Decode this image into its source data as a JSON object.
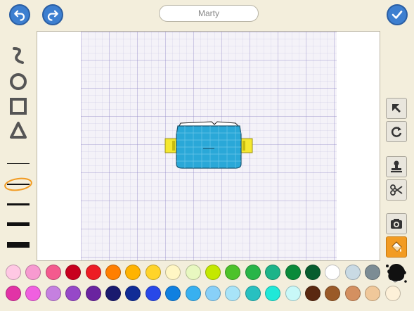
{
  "header": {
    "name_value": "Marty"
  },
  "icons": {
    "undo": "undo-arrow-icon",
    "redo": "redo-arrow-icon",
    "done": "checkmark-icon"
  },
  "shape_tools": [
    "freehand-squiggle",
    "ellipse",
    "rectangle",
    "triangle"
  ],
  "line_widths": [
    1,
    2,
    3,
    5,
    8
  ],
  "selected_line_width_index": 1,
  "right_tools": [
    "select-arrow",
    "rotate",
    "stamp",
    "cut-scissors",
    "camera",
    "paint-bucket"
  ],
  "active_right_tool": "paint-bucket",
  "accent_color": "#f29b22",
  "palette_row1": [
    "#ffc8e4",
    "#f79ad0",
    "#f45a8e",
    "#c8001e",
    "#ed1c24",
    "#ff7f00",
    "#ffb300",
    "#ffd42a",
    "#fff6c4",
    "#e8f8c0",
    "#c4e800",
    "#4cc22a",
    "#28b548",
    "#1cb489",
    "#0a8a3a",
    "#075d2e",
    "#ffffff",
    "#c9dae4",
    "#7c8c94"
  ],
  "palette_row2": [
    "#e233a6",
    "#f060e0",
    "#c580e0",
    "#9648c8",
    "#6a24a0",
    "#1a1a6e",
    "#102c96",
    "#2848e8",
    "#1080e0",
    "#38b0f0",
    "#88d0f8",
    "#a8e4f8",
    "#28c0c0",
    "#20e8d8",
    "#c8f8f8",
    "#5a2810",
    "#9a5a28",
    "#d49060",
    "#f0c89a",
    "#fdf0d8"
  ],
  "canvas_object": {
    "body_color": "#2aa8d8",
    "handle_color": "#f4e830"
  }
}
